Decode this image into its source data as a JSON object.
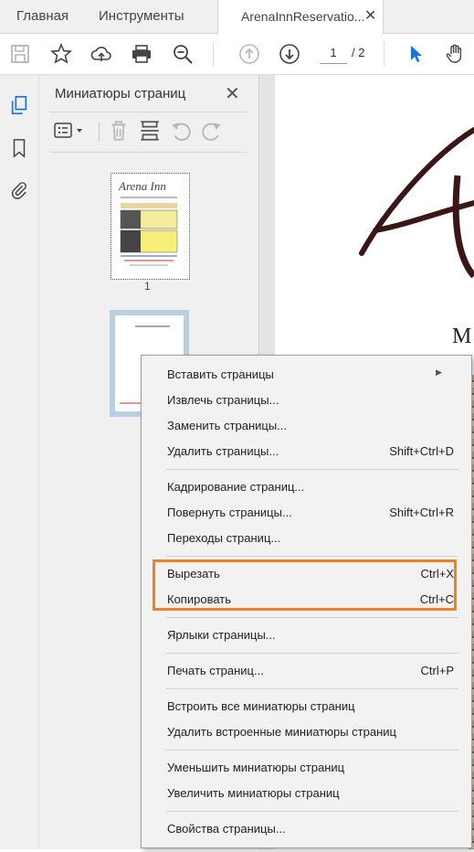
{
  "tabs": {
    "home": "Главная",
    "tools": "Инструменты",
    "document": "ArenaInnReservatio..."
  },
  "toolbar": {
    "page_current": "1",
    "page_total": "/ 2"
  },
  "panel": {
    "title": "Миниатюры страниц",
    "page1_number": "1"
  },
  "document": {
    "visible_letter": "М"
  },
  "thumbnail": {
    "brand_text": "Arena Inn"
  },
  "context_menu": {
    "items": [
      {
        "label": "Вставить страницы",
        "shortcut": "",
        "submenu": true
      },
      {
        "label": "Извлечь страницы...",
        "shortcut": ""
      },
      {
        "label": "Заменить страницы...",
        "shortcut": ""
      },
      {
        "label": "Удалить страницы...",
        "shortcut": "Shift+Ctrl+D"
      },
      {
        "label": "Кадрирование страниц...",
        "shortcut": ""
      },
      {
        "label": "Повернуть страницы...",
        "shortcut": "Shift+Ctrl+R"
      },
      {
        "label": "Переходы страниц...",
        "shortcut": ""
      },
      {
        "label": "Вырезать",
        "shortcut": "Ctrl+X"
      },
      {
        "label": "Копировать",
        "shortcut": "Ctrl+C"
      },
      {
        "label": "Ярлыки страницы...",
        "shortcut": ""
      },
      {
        "label": "Печать страниц...",
        "shortcut": "Ctrl+P"
      },
      {
        "label": "Встроить все миниатюры страниц",
        "shortcut": ""
      },
      {
        "label": "Удалить встроенные миниатюры страниц",
        "shortcut": ""
      },
      {
        "label": "Уменьшить миниатюры страниц",
        "shortcut": ""
      },
      {
        "label": "Увеличить миниатюры страниц",
        "shortcut": ""
      },
      {
        "label": "Свойства страницы...",
        "shortcut": ""
      }
    ]
  },
  "colors": {
    "highlight": "#f08022",
    "accent_cursor": "#1473e6"
  }
}
